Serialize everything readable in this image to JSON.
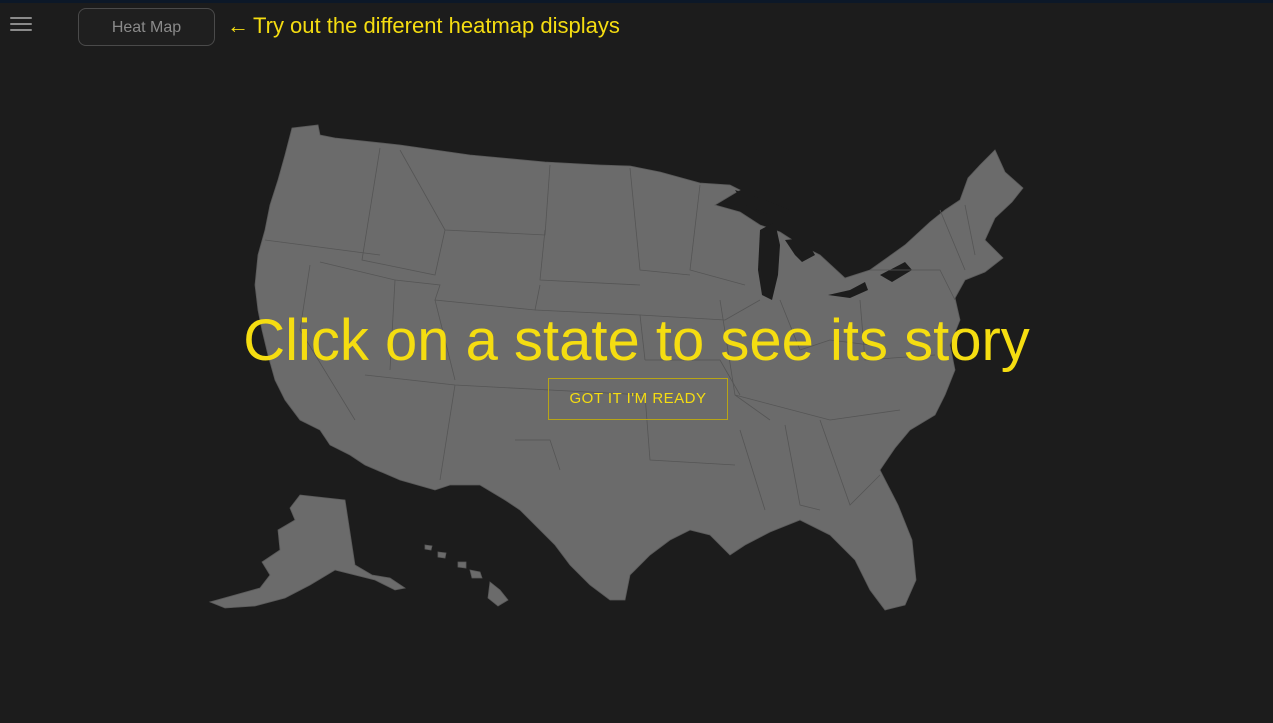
{
  "toolbar": {
    "menu_icon": "hamburger-icon",
    "view_button_label": "Heat Map",
    "hint_arrow": "←",
    "hint_text": "Try out the different heatmap displays"
  },
  "overlay": {
    "title": "Click on a state to see its story",
    "ready_button_label": "GOT IT I'M READY"
  },
  "colors": {
    "background": "#1c1c1c",
    "accent": "#f5dd11",
    "map_fill": "#6b6b6b"
  }
}
